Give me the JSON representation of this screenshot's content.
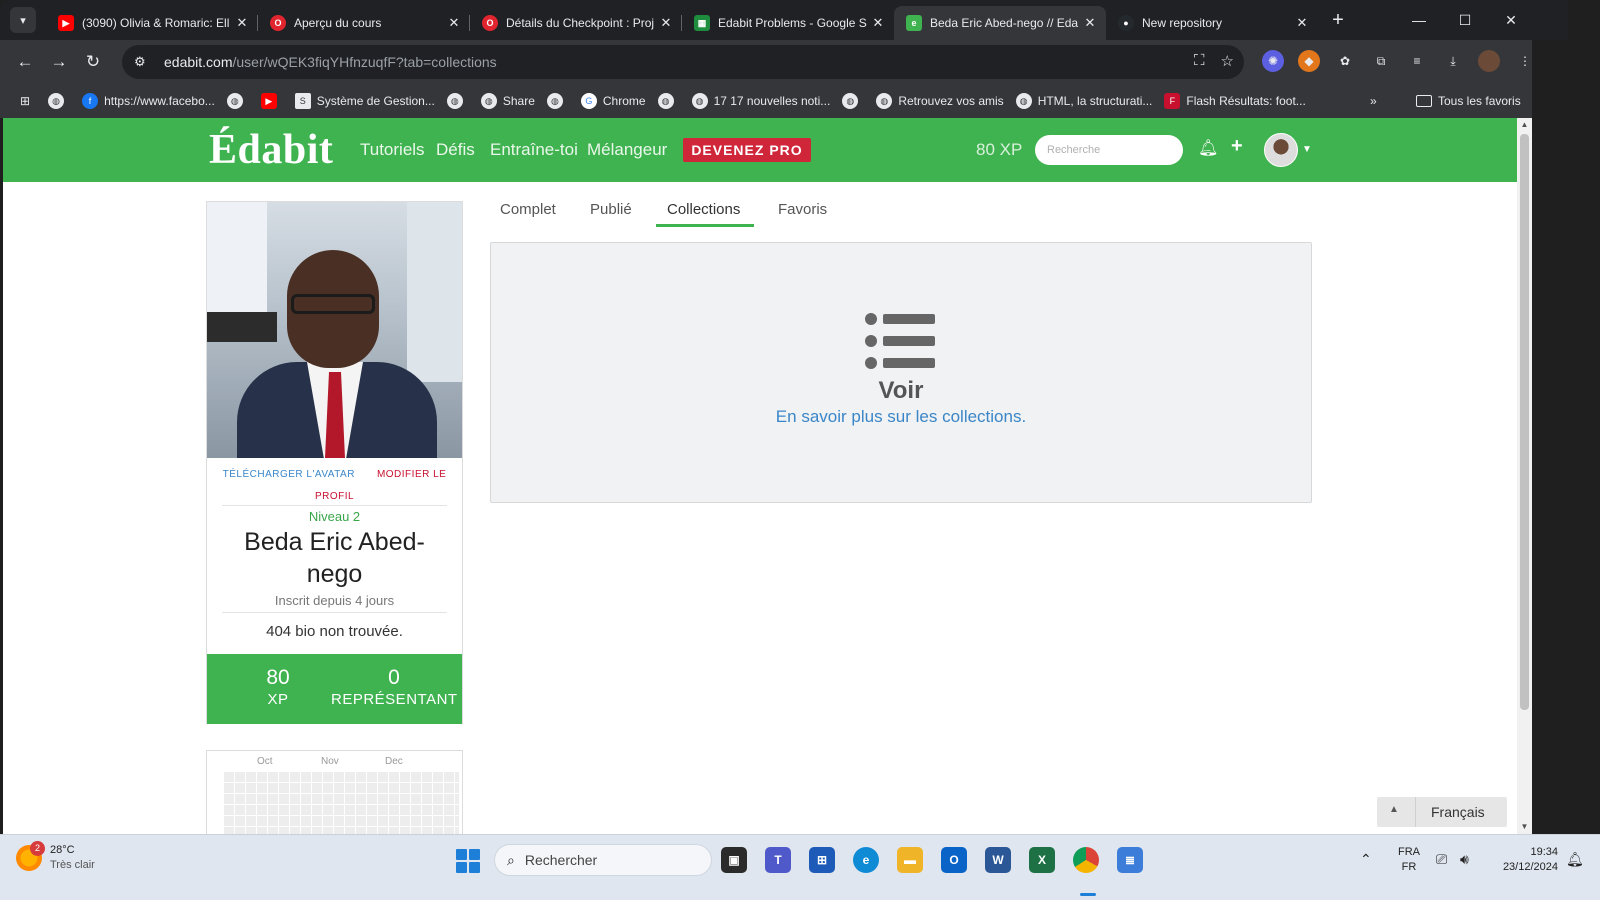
{
  "browser": {
    "tabs": [
      {
        "title": "(3090) Olivia & Romaric: Ell",
        "icon": "youtube-icon",
        "color": "#ff0000"
      },
      {
        "title": "Aperçu du cours",
        "icon": "opera-icon",
        "color": "#e0252f"
      },
      {
        "title": "Détails du Checkpoint : Proj",
        "icon": "opera-icon",
        "color": "#e0252f"
      },
      {
        "title": "Edabit Problems - Google S",
        "icon": "sheets-icon",
        "color": "#1e8e3e"
      },
      {
        "title": "Beda Eric Abed-nego // Eda",
        "icon": "edabit-icon",
        "color": "#40b351"
      },
      {
        "title": "New repository",
        "icon": "github-icon",
        "color": "#24292e"
      }
    ],
    "url_host": "edabit.com",
    "url_path": "/user/wQEK3fiqYHfnzuqfF?tab=collections",
    "bookmarks": [
      {
        "label": "https://www.facebo...",
        "icon": "facebook-icon"
      },
      {
        "label": "",
        "icon": "youtube-icon"
      },
      {
        "label": "Système de Gestion...",
        "icon": "sql-icon"
      },
      {
        "label": "Share",
        "icon": "globe-icon"
      },
      {
        "label": "Chrome",
        "icon": "google-icon"
      },
      {
        "label": "17 17 nouvelles noti...",
        "icon": "globe-icon"
      },
      {
        "label": "Retrouvez vos amis",
        "icon": "globe-icon"
      },
      {
        "label": "HTML, la structurati...",
        "icon": "globe-icon"
      },
      {
        "label": "Flash Résultats: foot...",
        "icon": "flashscore-icon"
      }
    ],
    "all_bookmarks": "Tous les favoris"
  },
  "site": {
    "logo": "Édabit",
    "nav": [
      "Tutoriels",
      "Défis",
      "Entraîne-toi",
      "Mélangeur"
    ],
    "pro_button": "DEVENEZ PRO",
    "xp": "80 XP",
    "search_placeholder": "Recherche",
    "accent": "#40b351",
    "pro_color": "#d0263a"
  },
  "profile": {
    "upload_avatar": "TÉLÉCHARGER L'AVATAR",
    "edit_profile_line1": "MODIFIER LE",
    "edit_profile_line2": "PROFIL",
    "level": "Niveau 2",
    "name_line1": "Beda Eric Abed-",
    "name_line2": "nego",
    "joined": "Inscrit  depuis 4 jours",
    "bio": "404 bio non trouvée.",
    "stats": [
      {
        "value": "80",
        "label": "XP"
      },
      {
        "value": "0",
        "label": "REPRÉSENTANT"
      }
    ],
    "calendar_months": [
      "Oct",
      "Nov",
      "Dec"
    ]
  },
  "profile_tabs": [
    "Complet",
    "Publié",
    "Collections",
    "Favoris"
  ],
  "active_tab": "Collections",
  "collections_panel": {
    "icon": "list-icon",
    "title": "Voir",
    "link": "En savoir plus sur les collections."
  },
  "language_button": "Français",
  "taskbar": {
    "temperature": "28°C",
    "weather": "Très clair",
    "weather_badge": "2",
    "search_placeholder": "Rechercher",
    "lang_top": "FRA",
    "lang_bottom": "FR",
    "time": "19:34",
    "date": "23/12/2024"
  }
}
